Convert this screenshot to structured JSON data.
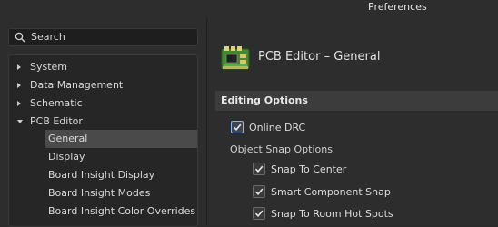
{
  "window": {
    "title": "Preferences"
  },
  "search": {
    "placeholder": "Search"
  },
  "tree": {
    "items": [
      {
        "label": "System",
        "expanded": false
      },
      {
        "label": "Data Management",
        "expanded": false
      },
      {
        "label": "Schematic",
        "expanded": false
      },
      {
        "label": "PCB Editor",
        "expanded": true
      }
    ],
    "children": [
      {
        "label": "General",
        "selected": true
      },
      {
        "label": "Display"
      },
      {
        "label": "Board Insight Display"
      },
      {
        "label": "Board Insight Modes"
      },
      {
        "label": "Board Insight Color Overrides"
      }
    ]
  },
  "page": {
    "title": "PCB Editor – General",
    "section": "Editing Options",
    "online_drc": {
      "label": "Online DRC",
      "checked": true
    },
    "snap_group_label": "Object Snap Options",
    "snap_options": [
      {
        "label": "Snap To Center",
        "checked": true
      },
      {
        "label": "Smart Component Snap",
        "checked": true
      },
      {
        "label": "Snap To Room Hot Spots",
        "checked": true
      }
    ]
  },
  "colors": {
    "background": "#2b2b2b",
    "selected": "#4a4a4a",
    "section_bar": "#3c3c3c",
    "pcb_green": "#4a9a3a"
  }
}
